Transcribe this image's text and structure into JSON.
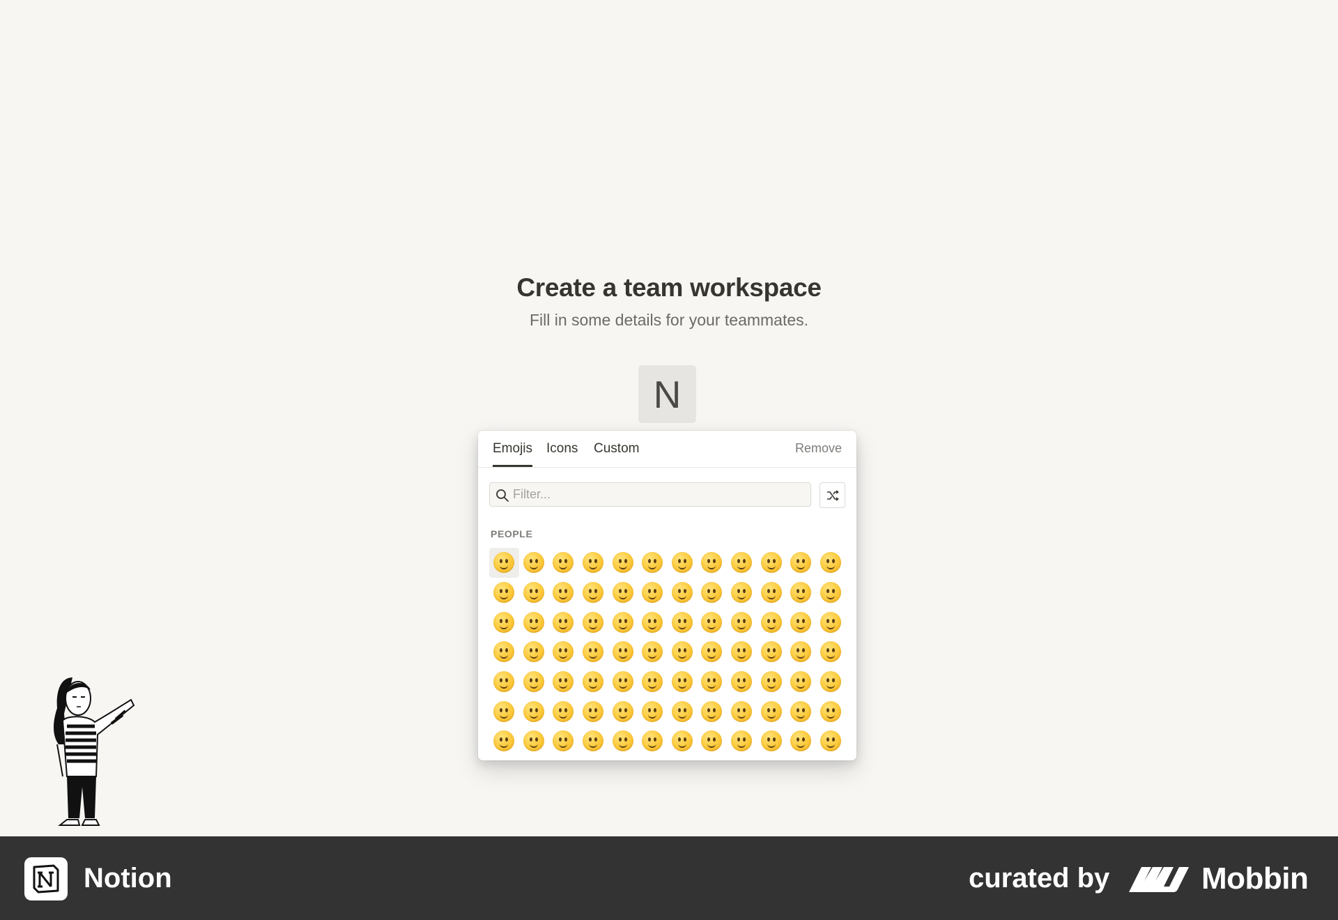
{
  "page": {
    "title": "Create a team workspace",
    "subtitle": "Fill in some details for your teammates."
  },
  "workspace_icon": {
    "letter": "N"
  },
  "picker": {
    "tabs": [
      {
        "label": "Emojis",
        "active": true
      },
      {
        "label": "Icons",
        "active": false
      },
      {
        "label": "Custom",
        "active": false
      }
    ],
    "remove_label": "Remove",
    "filter_placeholder": "Filter...",
    "section_label": "PEOPLE",
    "emoji_rows": 7,
    "emoji_columns": 12,
    "selected_emoji_index": 0
  },
  "footer": {
    "app_name": "Notion",
    "curated_label": "curated by",
    "brand": "Mobbin"
  },
  "colors": {
    "background": "#f7f6f3",
    "footer": "#333333",
    "text": "#37352f"
  }
}
